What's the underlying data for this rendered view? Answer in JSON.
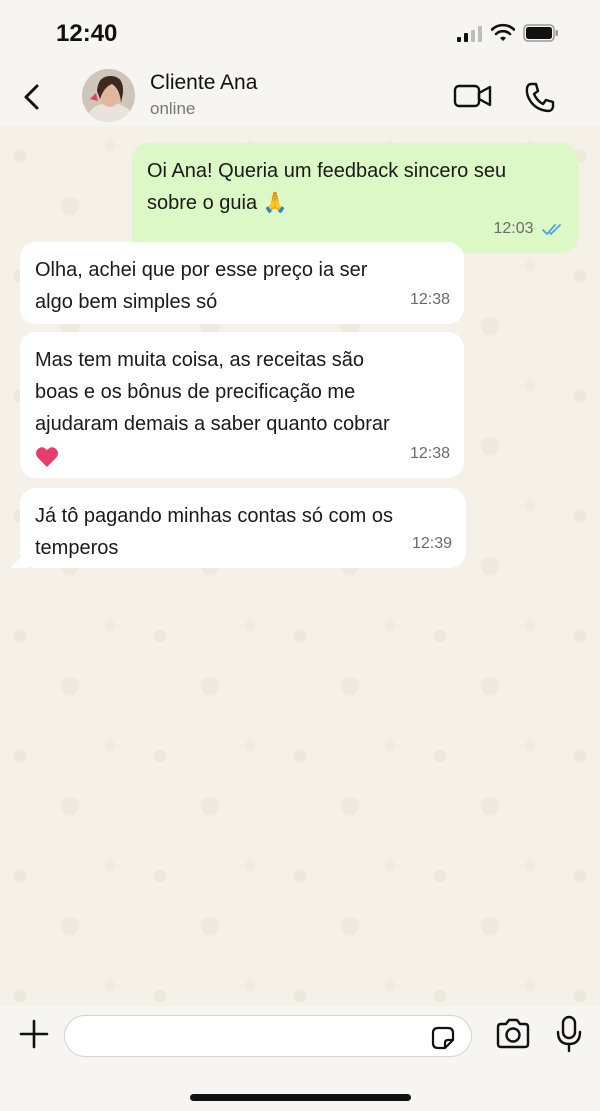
{
  "status_bar": {
    "time": "12:40"
  },
  "header": {
    "contact_name": "Cliente Ana",
    "contact_status": "online"
  },
  "messages": [
    {
      "direction": "outgoing",
      "lines": [
        "Oi Ana! Queria um feedback sincero seu",
        "sobre o guia"
      ],
      "emoji": "🙏",
      "time": "12:03",
      "read_receipt": "double-check-blue"
    },
    {
      "direction": "incoming",
      "lines": [
        "Olha, achei que por esse preço ia ser",
        "algo bem simples só"
      ],
      "time": "12:38"
    },
    {
      "direction": "incoming",
      "lines": [
        "Mas tem muita coisa, as receitas são",
        "boas e os bônus de precificação me",
        "ajudaram demais a saber quanto cobrar"
      ],
      "emoji": "❤️",
      "time": "12:38"
    },
    {
      "direction": "incoming",
      "lines": [
        "Já tô pagando minhas contas só com os",
        "temperos"
      ],
      "time": "12:39"
    }
  ],
  "input": {
    "placeholder": ""
  },
  "colors": {
    "outgoing_bubble": "#dcf8c6",
    "incoming_bubble": "#ffffff",
    "read_check": "#4fa3e0",
    "heart": "#e63e6a"
  },
  "icons": [
    "back-icon",
    "video-icon",
    "phone-icon",
    "plus-icon",
    "sticker-icon",
    "camera-icon",
    "mic-icon",
    "signal-icon",
    "wifi-icon",
    "battery-icon"
  ]
}
